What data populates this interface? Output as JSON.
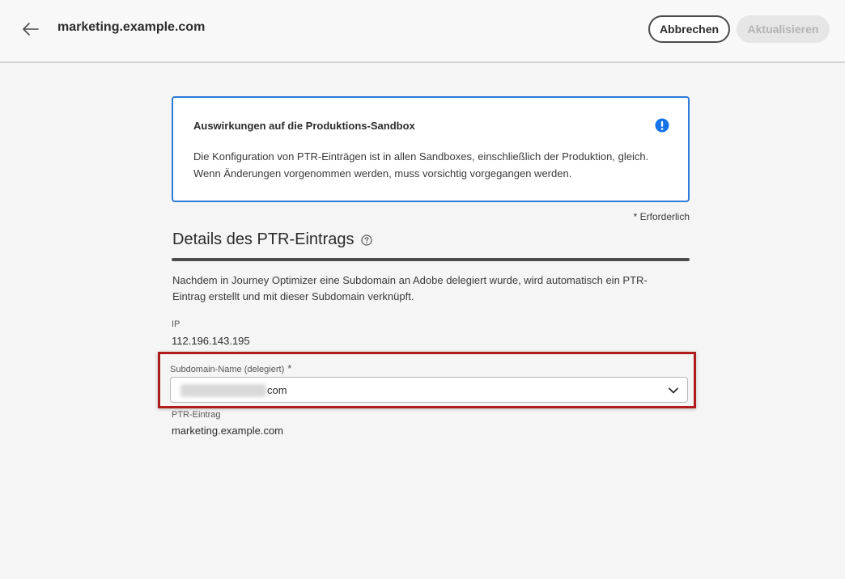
{
  "header": {
    "title": "marketing.example.com",
    "cancel_label": "Abbrechen",
    "update_label": "Aktualisieren"
  },
  "alert": {
    "title": "Auswirkungen auf die Produktions-Sandbox",
    "body": "Die Konfiguration von PTR-Einträgen ist in allen Sandboxes, einschließlich der Produktion, gleich. Wenn Änderungen vorgenommen werden, muss vorsichtig vorgegangen werden."
  },
  "form": {
    "required_note": "* Erforderlich",
    "section_title": "Details des PTR-Eintrags",
    "section_description": "Nachdem in Journey Optimizer eine Subdomain an Adobe delegiert wurde, wird automatisch ein PTR-Eintrag erstellt und mit dieser Subdomain verknüpft.",
    "ip": {
      "label": "IP",
      "value": "112.196.143.195"
    },
    "subdomain": {
      "label": "Subdomain-Name (delegiert)",
      "required_mark": "*",
      "value_suffix": "com"
    },
    "ptr": {
      "label": "PTR-Eintrag",
      "value": "marketing.example.com"
    }
  },
  "colors": {
    "accent_blue": "#2b7bd9",
    "highlight_red": "#b01c1c",
    "info_icon": "#1473e6"
  },
  "icons": {
    "back": "arrow-left-icon",
    "info": "info-icon",
    "help": "help-icon",
    "dropdown": "chevron-down-icon"
  }
}
